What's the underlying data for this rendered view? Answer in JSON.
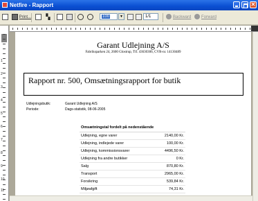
{
  "window": {
    "title": "Netfire - Rapport"
  },
  "toolbar": {
    "print_label": "Print...",
    "zoom_value": "100",
    "page_value": "1/1",
    "back_label": "Backward",
    "forward_label": "Forward"
  },
  "ruler": {
    "vertical_numbers": [
      "1",
      "2",
      "3",
      "4",
      "5",
      "6",
      "7",
      "8",
      "9",
      "10",
      "11",
      "12",
      "13"
    ]
  },
  "document": {
    "company_name": "Garant Udlejning A/S",
    "company_address": "Fabriksparken 24, 2600 Glostrup, Tlf. 43630306, CVR-nr. 14130489",
    "report_title": "Rapport nr. 500, Omsætningsrapport for butik",
    "fields": [
      {
        "label": "Udlejningsbutik:",
        "value": "Garant Udlejning A/S"
      },
      {
        "label": "Periode:",
        "value": "Dags-statistik, 08-06-2005"
      }
    ],
    "table": {
      "header": "Omsætningstal fordelt på nedenstående",
      "rows": [
        {
          "label": "Udlejning, egne varer",
          "value": "2140,00 Kr."
        },
        {
          "label": "Udlejning, indlejede varer",
          "value": "100,00 Kr."
        },
        {
          "label": "Udlejning, kommissionsvarer",
          "value": "4496,50 Kr."
        },
        {
          "label": "Udlejning fra andre butikker",
          "value": "0 Kr."
        },
        {
          "label": "Salg",
          "value": "870,80 Kr."
        },
        {
          "label": "Transport",
          "value": "2965,00 Kr."
        },
        {
          "label": "Forsikring",
          "value": "539,84 Kr."
        },
        {
          "label": "Miljøafgift",
          "value": "74,31 Kr."
        }
      ]
    }
  },
  "colors": {
    "titlebar": "#0a4fd2",
    "toolbar": "#ece9d8",
    "page": "#ffffff",
    "selection": "#316ac5"
  }
}
